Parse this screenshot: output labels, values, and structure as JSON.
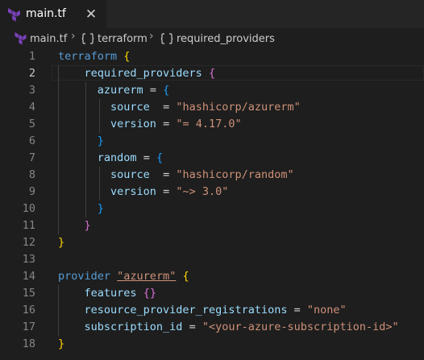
{
  "tab": {
    "filename": "main.tf",
    "close_glyph": "✕",
    "icon": "terraform-icon"
  },
  "breadcrumb": {
    "file": "main.tf",
    "items": [
      "terraform",
      "required_providers"
    ],
    "separator": "›"
  },
  "editor": {
    "active_line": 2,
    "line_numbers": [
      "1",
      "2",
      "3",
      "4",
      "5",
      "6",
      "7",
      "8",
      "9",
      "10",
      "11",
      "12",
      "13",
      "14",
      "15",
      "16",
      "17",
      "18"
    ],
    "tokens": {
      "l1_kw": "terraform",
      "l1_brace": "{",
      "l2_prop": "required_providers",
      "l2_brace": "{",
      "l3_prop": "azurerm",
      "l3_eq": " = ",
      "l3_brace": "{",
      "l4_prop": "source",
      "l4_eq": "  = ",
      "l4_str": "\"hashicorp/azurerm\"",
      "l5_prop": "version",
      "l5_eq": " = ",
      "l5_str": "\"= 4.17.0\"",
      "l6_brace": "}",
      "l7_prop": "random",
      "l7_eq": " = ",
      "l7_brace": "{",
      "l8_prop": "source",
      "l8_eq": "  = ",
      "l8_str": "\"hashicorp/random\"",
      "l9_prop": "version",
      "l9_eq": " = ",
      "l9_str": "\"~> 3.0\"",
      "l10_brace": "}",
      "l11_brace": "}",
      "l12_brace": "}",
      "l14_kw": "provider",
      "l14_str": "\"azurerm\"",
      "l14_brace": "{",
      "l15_prop": "features",
      "l15_brace": "{}",
      "l16_prop": "resource_provider_registrations",
      "l16_eq": " = ",
      "l16_str": "\"none\"",
      "l17_prop": "subscription_id",
      "l17_eq": " = ",
      "l17_str": "\"<your-azure-subscription-id>\"",
      "l18_brace": "}"
    }
  },
  "colors": {
    "background": "#1e1e1e",
    "keyword": "#569cd6",
    "property": "#9cdcfe",
    "string": "#ce9178",
    "bracket_1": "#ffd700",
    "bracket_2": "#da70d6",
    "bracket_3": "#179fff",
    "terraform_brand": "#7b42bc"
  }
}
